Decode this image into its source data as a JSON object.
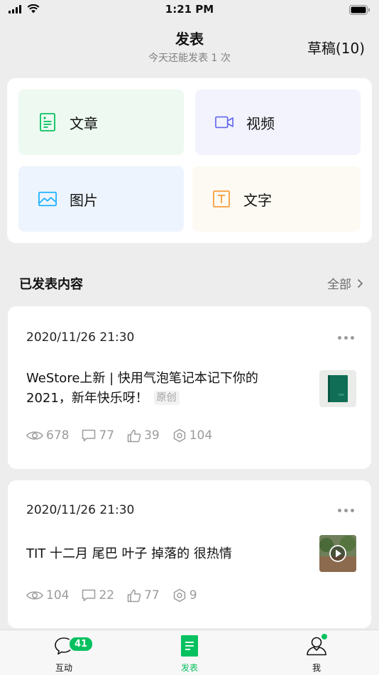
{
  "status_bar": {
    "time": "1:21 PM"
  },
  "header": {
    "title": "发表",
    "subtitle": "今天还能发表 1 次",
    "drafts_label": "草稿(10)"
  },
  "publish_options": [
    {
      "label": "文章",
      "icon": "article-icon",
      "color": "#07c160"
    },
    {
      "label": "视频",
      "icon": "video-icon",
      "color": "#6467f0"
    },
    {
      "label": "图片",
      "icon": "image-icon",
      "color": "#10aeff"
    },
    {
      "label": "文字",
      "icon": "text-icon",
      "color": "#fa9d3b"
    }
  ],
  "published": {
    "section_title": "已发表内容",
    "view_all_label": "全部"
  },
  "posts": [
    {
      "date": "2020/11/26 21:30",
      "title": "WeStore上新 | 快用气泡笔记本记下你的2021，新年快乐呀！",
      "badge": "原创",
      "thumbnail": "notebook-thumbnail",
      "views": "678",
      "comments": "77",
      "likes": "39",
      "shares": "104"
    },
    {
      "date": "2020/11/26 21:30",
      "title": "TIT 十二月 尾巴 叶子 掉落的 很热情",
      "thumbnail": "video-thumbnail",
      "views": "104",
      "comments": "22",
      "likes": "77",
      "shares": "9"
    }
  ],
  "tab_bar": {
    "tabs": [
      {
        "label": "互动",
        "badge": "41"
      },
      {
        "label": "发表",
        "active": true
      },
      {
        "label": "我"
      }
    ]
  }
}
